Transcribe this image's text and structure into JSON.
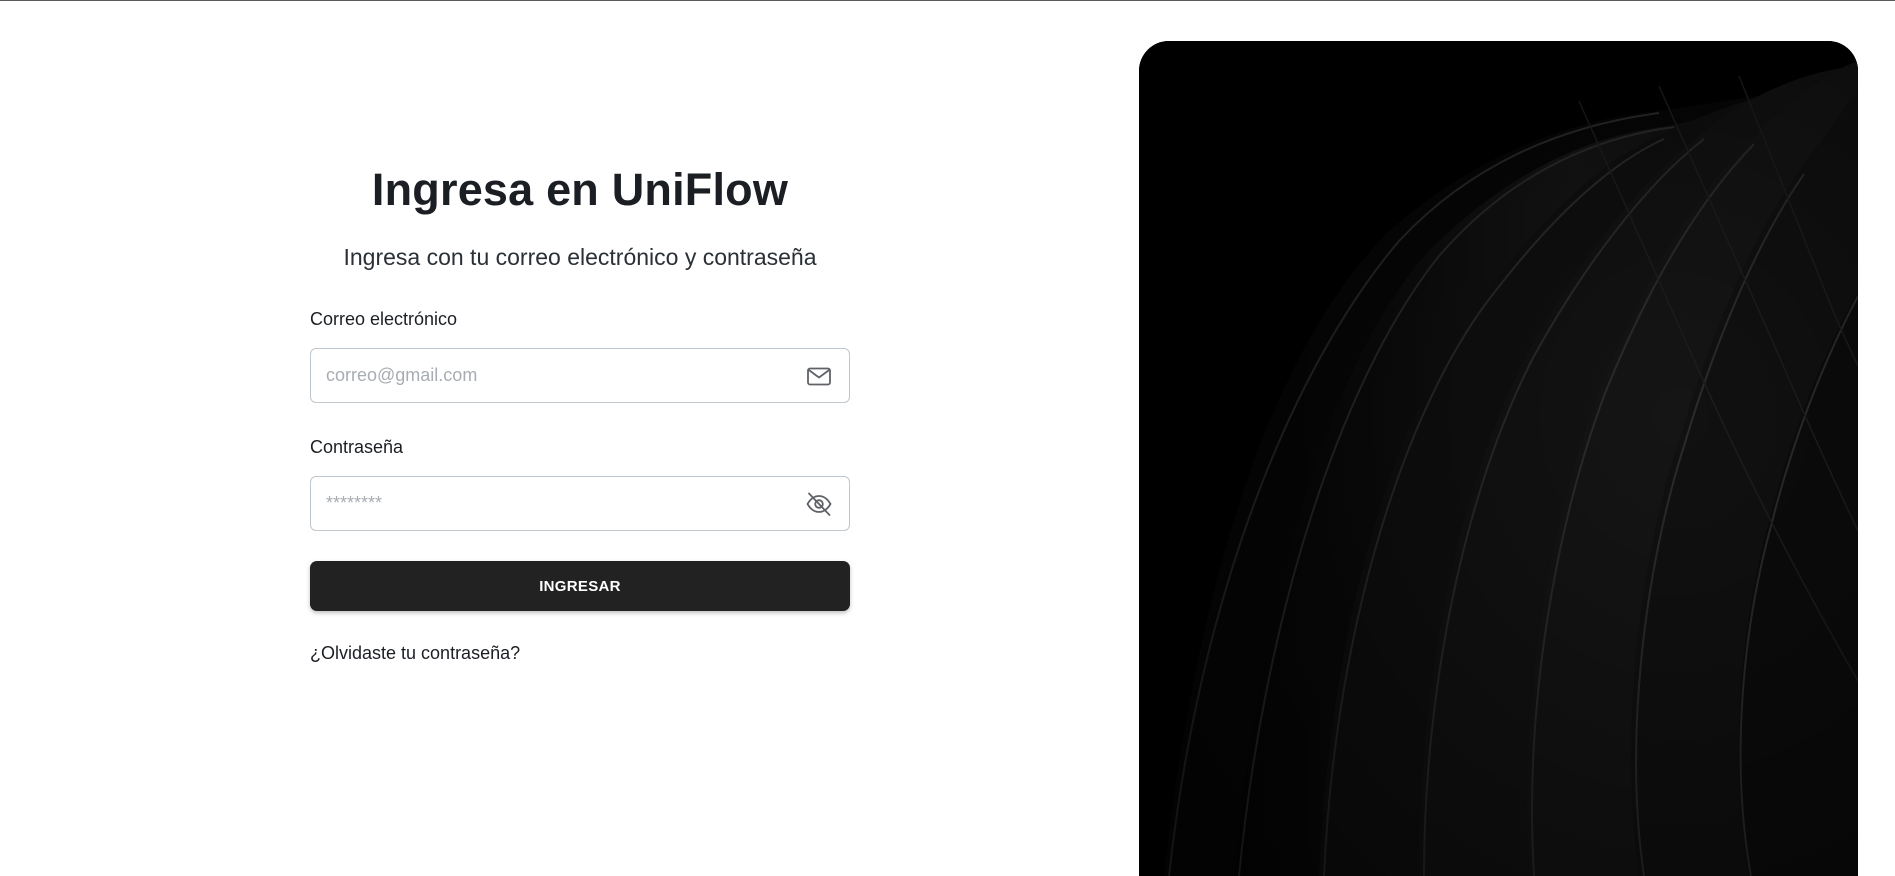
{
  "login": {
    "title": "Ingresa en UniFlow",
    "subtitle": "Ingresa con tu correo electrónico y contraseña",
    "email": {
      "label": "Correo electrónico",
      "placeholder": "correo@gmail.com",
      "value": "",
      "icon": "mail-icon"
    },
    "password": {
      "label": "Contraseña",
      "placeholder": "********",
      "value": "",
      "icon": "eye-off-icon"
    },
    "submit_label": "INGRESAR",
    "forgot_label": "¿Olvidaste tu contraseña?"
  },
  "colors": {
    "primary_button": "#222222",
    "text": "#1b1f24",
    "input_border": "#bfc6cc",
    "placeholder": "#a7adb3",
    "art_background": "#000000"
  }
}
